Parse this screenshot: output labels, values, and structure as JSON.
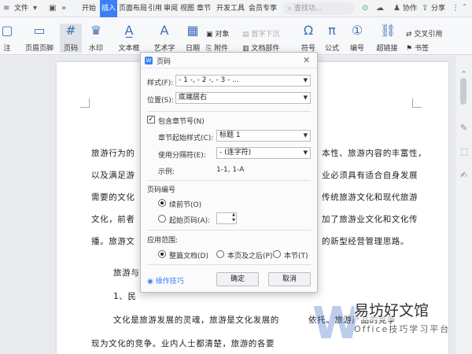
{
  "menubar": {
    "file": "文件",
    "items": [
      {
        "label": "开始"
      },
      {
        "label": "插入"
      },
      {
        "label": "页面布局"
      },
      {
        "label": "引用"
      },
      {
        "label": "审阅"
      },
      {
        "label": "视图"
      },
      {
        "label": "章节"
      },
      {
        "label": "开发工具"
      },
      {
        "label": "会员专享"
      }
    ],
    "active_index": 1,
    "search": "查找功...",
    "collab": "协作",
    "share": "分享"
  },
  "ribbon": {
    "page_header_footer": "页眉页脚",
    "page_number": "页码",
    "watermark": "水印",
    "textbox": "文本框",
    "wordart": "艺术字",
    "date": "日期",
    "object": "对象",
    "attachment": "附件",
    "doc_parts": "文档部件",
    "first_drop": "首字下沉",
    "symbol": "符号",
    "formula": "公式",
    "numbering": "编号",
    "hyperlink": "超链接",
    "crossref": "交叉引用",
    "bookmark": "书签",
    "left_cut": "注"
  },
  "document": {
    "lines": [
      "旅游行为的",
      "以及满足游",
      "需要的文化",
      "文化，前者",
      "播。旅游文",
      "旅游与",
      "1、民",
      "文化是旅游发展的灵魂，旅游是文化发展的",
      "现为文化的竞争。业内人士都清楚，旅游的各要"
    ],
    "right_lines": [
      "本性、旅游内容的丰富性，",
      "业必须具有适合自身发展",
      "传统旅游文化和现代旅游",
      "加了旅游业文化和文化传",
      "的新型经营管理思路。",
      "依托。旅游产品的竞争"
    ]
  },
  "dialog": {
    "title": "页码",
    "style_label": "样式(F):",
    "style_value": "- 1 -, - 2 -, - 3 - ...",
    "position_label": "位置(S):",
    "position_value": "底端居右",
    "include_chapter": "包含章节号(N)",
    "include_checked": true,
    "chapter_style_label": "章节起始样式(C):",
    "chapter_style_value": "标题 1",
    "separator_label": "使用分隔符(E):",
    "separator_value": "-     (连字符)",
    "example_label": "示例:",
    "example_value": "1-1, 1-A",
    "numbering_group": "页码编号",
    "continue_prev": "续前节(O)",
    "start_at": "起始页码(A):",
    "numbering_selected": "continue",
    "scope_group": "应用范围:",
    "scope_whole": "整篇文档(D)",
    "scope_after": "本页及之后(P)",
    "scope_section": "本节(T)",
    "scope_selected": "whole",
    "tips": "操作技巧",
    "ok": "确定",
    "cancel": "取消"
  },
  "watermark": {
    "text": "易坊好文馆",
    "sub": "Office技巧学习平台"
  },
  "colors": {
    "accent": "#3a7ff6",
    "ribbon_icon": "#3d6fb5"
  }
}
